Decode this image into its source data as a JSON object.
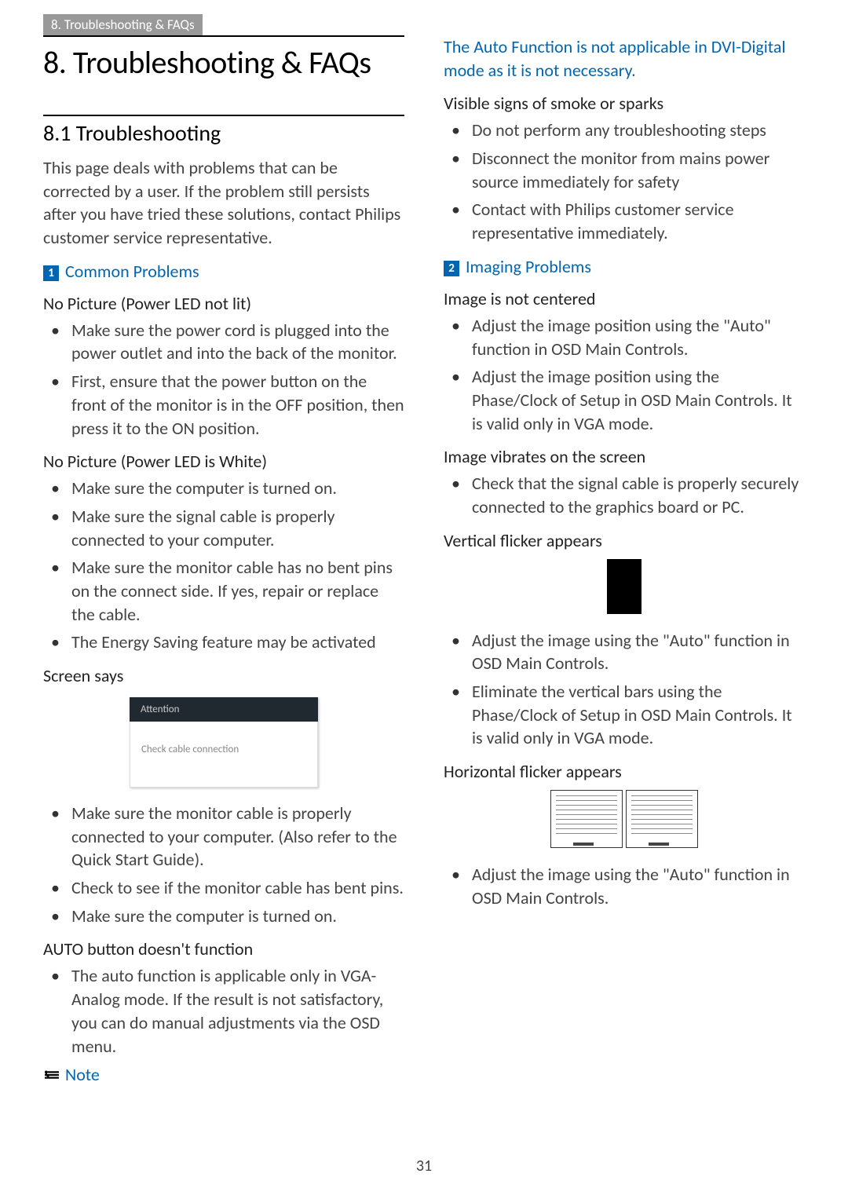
{
  "top_tab": "8. Troubleshooting & FAQs",
  "chapter_title": "8.  Troubleshooting & FAQs",
  "section_title": "8.1  Troubleshooting",
  "intro": "This page deals with problems that can be corrected by a user. If the problem still persists after you have tried these solutions, contact Philips customer service representative.",
  "num1": "1",
  "common_problems": "Common Problems",
  "sub_no_pic_led_off": "No Picture (Power LED not lit)",
  "b1a": "Make sure the power cord is plugged into the power outlet and into the back of the monitor.",
  "b1b": "First, ensure that the power button on the front of the monitor is in the OFF position, then press it to the ON position.",
  "sub_no_pic_white": "No Picture (Power LED is White)",
  "b2a": "Make sure the computer is turned on.",
  "b2b": "Make sure the signal cable is properly connected to your computer.",
  "b2c": "Make sure the monitor cable has no bent pins on the connect side. If yes, repair or replace the cable.",
  "b2d": "The Energy Saving feature may be activated",
  "sub_screen_says": "Screen says",
  "screen_attention": "Attention",
  "screen_msg": "Check cable connection",
  "b3a": "Make sure the monitor cable is properly connected to your computer. (Also refer to the Quick Start Guide).",
  "b3b": "Check to see if the monitor cable has bent pins.",
  "b3c": "Make sure the computer is turned on.",
  "sub_auto": "AUTO button doesn't function",
  "b4a": "The auto function is applicable only in VGA-Analog mode.  If the result is not satisfactory, you can do manual adjustments via the OSD menu.",
  "note_label": "Note",
  "note_text": "The Auto Function is not applicable in DVI-Digital mode as it is not necessary.",
  "sub_smoke": "Visible signs of smoke or sparks",
  "b5a": "Do not perform any troubleshooting steps",
  "b5b": "Disconnect the monitor from mains power source immediately for safety",
  "b5c": "Contact with Philips customer service representative immediately.",
  "num2": "2",
  "imaging_problems": "Imaging Problems",
  "sub_not_centered": "Image is not centered",
  "b6a": "Adjust the image position using the \"Auto\" function in OSD Main Controls.",
  "b6b": "Adjust the image position using the Phase/Clock of Setup in OSD Main Controls.  It is valid only in VGA mode.",
  "sub_vibrates": "Image vibrates on the screen",
  "b7a": "Check that the signal cable is properly securely connected to the graphics board or PC.",
  "sub_vflicker": "Vertical flicker appears",
  "b8a": "Adjust the image using the \"Auto\" function in OSD Main Controls.",
  "b8b": "Eliminate the vertical bars using the Phase/Clock of Setup in OSD Main Controls. It is valid only in VGA mode.",
  "sub_hflicker": "Horizontal flicker appears",
  "b9a": "Adjust the image using the \"Auto\" function in OSD Main Controls.",
  "page_number": "31"
}
